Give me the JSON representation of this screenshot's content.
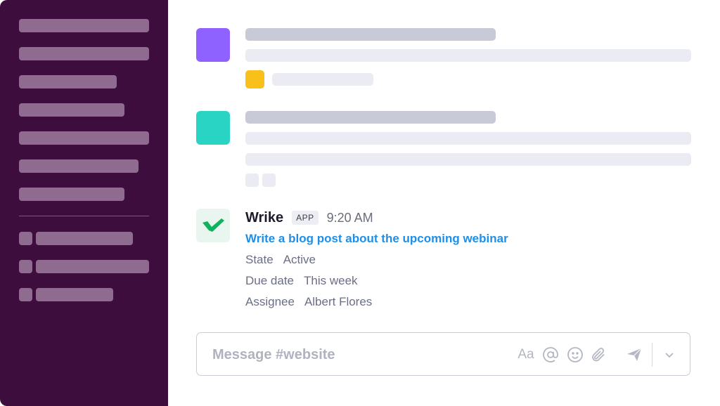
{
  "message": {
    "sender": "Wrike",
    "badge": "APP",
    "time": "9:20 AM",
    "task_title": "Write a blog post about the upcoming webinar",
    "fields": [
      {
        "label": "State",
        "value": "Active"
      },
      {
        "label": "Due date",
        "value": "This week"
      },
      {
        "label": "Assignee",
        "value": "Albert Flores"
      }
    ]
  },
  "composer": {
    "placeholder": "Message #website",
    "format_label": "Aa"
  },
  "icons": {
    "mention": "at-icon",
    "emoji": "emoji-icon",
    "attach": "paperclip-icon",
    "send": "send-icon",
    "more": "chevron-down-icon"
  },
  "colors": {
    "sidebar": "#3d0d3d",
    "avatar_purple": "#8e62ff",
    "avatar_teal": "#2ad4c5",
    "reaction_yellow": "#f8c018",
    "link_blue": "#1f8ee6",
    "wrike_green": "#0fb35e"
  }
}
